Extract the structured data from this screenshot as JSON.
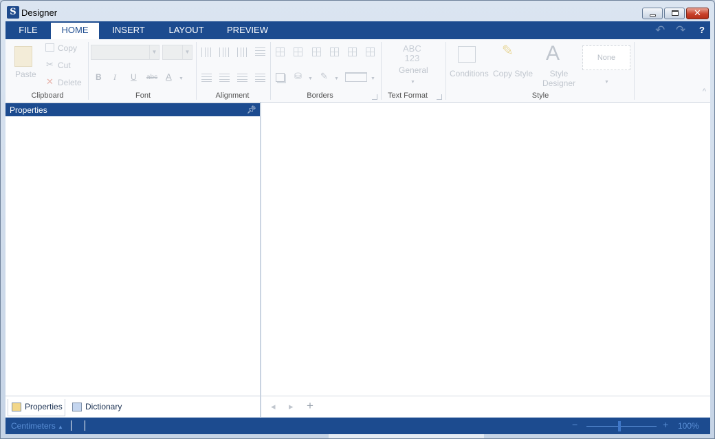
{
  "window": {
    "title": "Designer",
    "app_logo_glyph": "S",
    "close_glyph": "✕"
  },
  "ribbon_tabs": [
    "FILE",
    "HOME",
    "INSERT",
    "LAYOUT",
    "PREVIEW"
  ],
  "active_tab": "HOME",
  "quick_access": {
    "undo_icon": "undo-icon",
    "redo_icon": "redo-icon",
    "help_label": "?"
  },
  "clipboard": {
    "paste": "Paste",
    "copy": "Copy",
    "cut": "Cut",
    "delete": "Delete",
    "group": "Clipboard"
  },
  "font": {
    "bold": "B",
    "italic": "I",
    "underline": "U",
    "strike": "abc",
    "color": "A",
    "group": "Font"
  },
  "alignment": {
    "group": "Alignment"
  },
  "borders": {
    "group": "Borders"
  },
  "text_format": {
    "sample_line1": "ABC",
    "sample_line2": "123",
    "value": "General",
    "group": "Text Format"
  },
  "style": {
    "conditions": "Conditions",
    "copy_style": "Copy Style",
    "style_designer_1": "Style",
    "style_designer_2": "Designer",
    "style_none": "None",
    "group": "Style"
  },
  "left_panel": {
    "title": "Properties",
    "tabs": [
      "Properties",
      "Dictionary"
    ]
  },
  "status_bar": {
    "units": "Centimeters",
    "zoom": "100%"
  },
  "colors": {
    "accent": "#1c4b8f",
    "ribbon_bg": "#f8f9fb",
    "disabled": "#c0c6ce",
    "status_text": "#5a8fd6"
  }
}
